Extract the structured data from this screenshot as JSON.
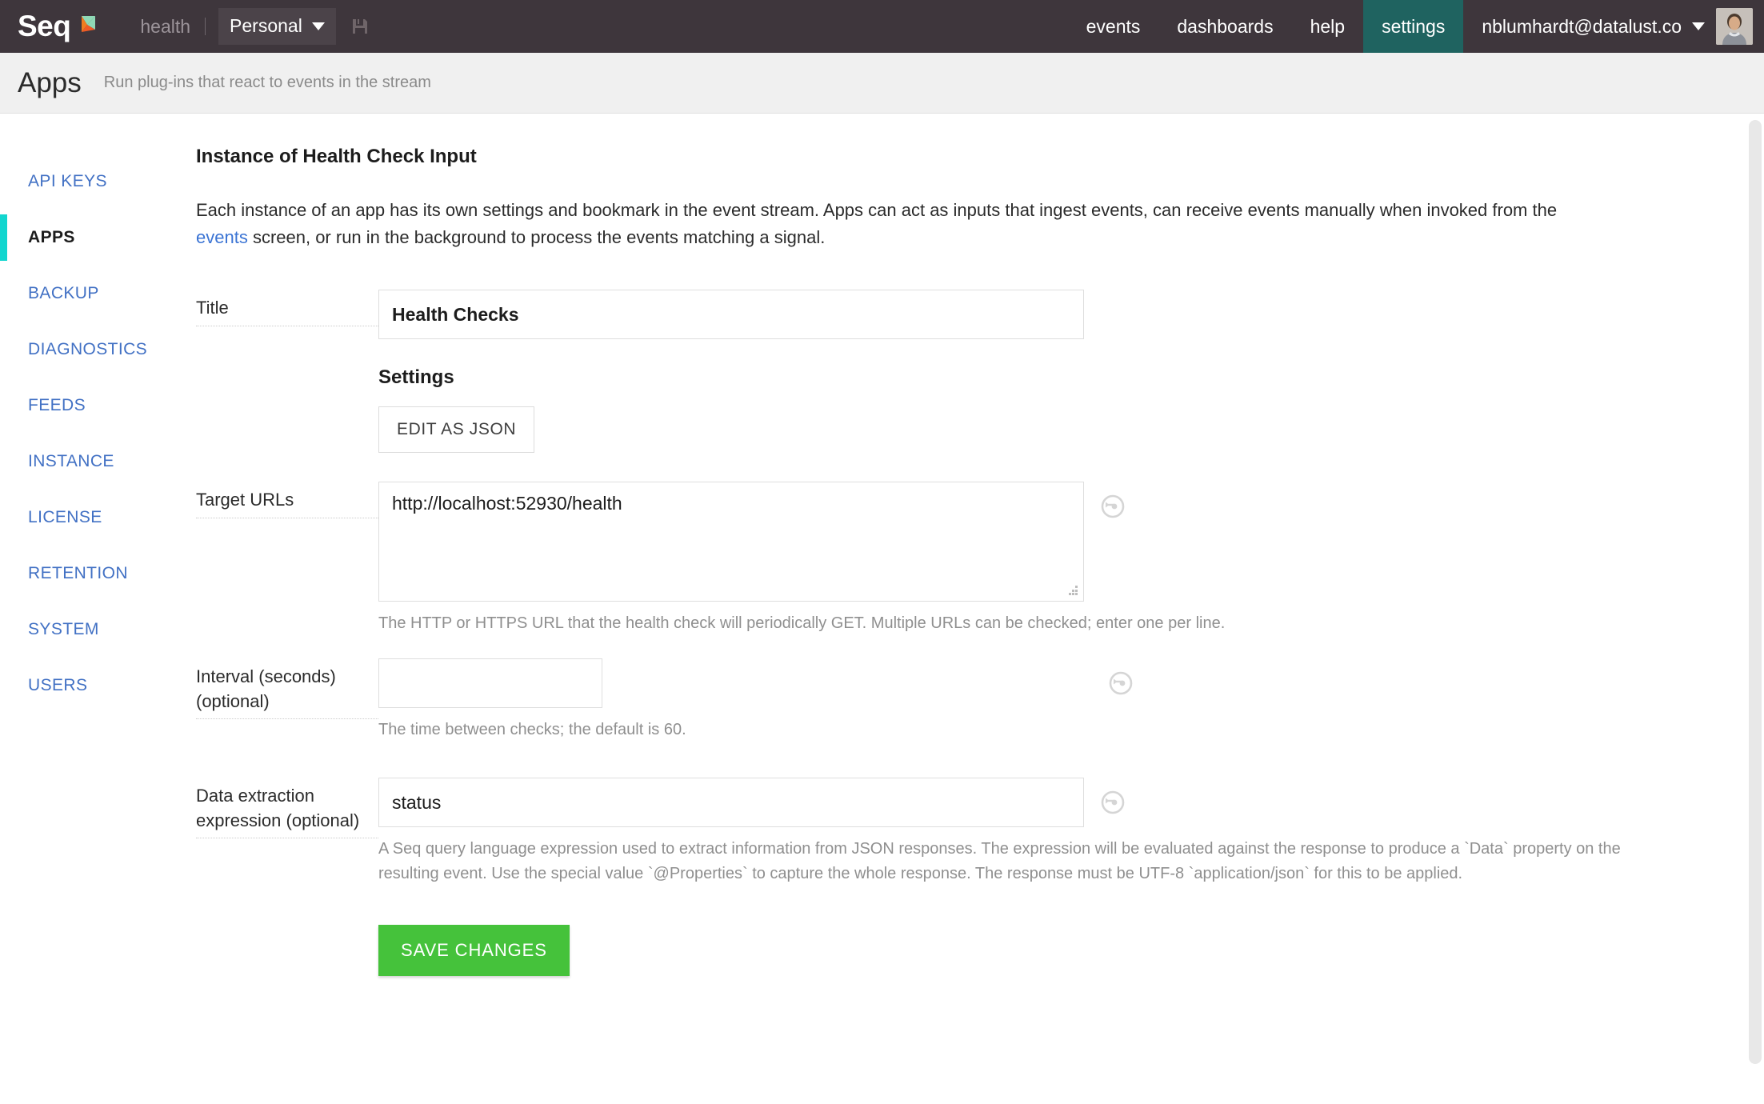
{
  "topnav": {
    "brand": "Seq",
    "brand_mark_icon": "seq-flag-logo",
    "context_name": "health",
    "workspace_label": "Personal",
    "workspace_caret_icon": "chevron-down-icon",
    "save_view_icon": "floppy-save-icon",
    "links": [
      {
        "label": "events",
        "active": false
      },
      {
        "label": "dashboards",
        "active": false
      },
      {
        "label": "help",
        "active": false
      },
      {
        "label": "settings",
        "active": true
      }
    ],
    "user_email": "nblumhardt@datalust.co",
    "user_caret_icon": "chevron-down-icon",
    "avatar_icon": "user-avatar",
    "colors": {
      "nav_background": "#3e363c",
      "active_tab": "#1f6360",
      "workspace_chip": "#4b4349"
    }
  },
  "page_header": {
    "title": "Apps",
    "subtitle": "Run plug-ins that react to events in the stream"
  },
  "sidebar": {
    "items": [
      {
        "label": "API KEYS",
        "active": false
      },
      {
        "label": "APPS",
        "active": true
      },
      {
        "label": "BACKUP",
        "active": false
      },
      {
        "label": "DIAGNOSTICS",
        "active": false
      },
      {
        "label": "FEEDS",
        "active": false
      },
      {
        "label": "INSTANCE",
        "active": false
      },
      {
        "label": "LICENSE",
        "active": false
      },
      {
        "label": "RETENTION",
        "active": false
      },
      {
        "label": "SYSTEM",
        "active": false
      },
      {
        "label": "USERS",
        "active": false
      }
    ],
    "active_marker_color": "#12d6cf",
    "link_color": "#4271c4"
  },
  "main": {
    "heading": "Instance of Health Check Input",
    "description_part1": "Each instance of an app has its own settings and bookmark in the event stream. Apps can act as inputs that ingest events, can receive events manually when invoked from the ",
    "description_link": "events",
    "description_part2": " screen, or run in the background to process the events matching a signal.",
    "app_logo_icon": "app-logo-mark",
    "title_field": {
      "label": "Title",
      "value": "Health Checks",
      "placeholder": ""
    },
    "settings_heading": "Settings",
    "edit_as_json_label": "EDIT AS JSON",
    "target_urls_field": {
      "label": "Target URLs",
      "value": "http://localhost:52930/health",
      "placeholder": "",
      "help": "The HTTP or HTTPS URL that the health check will periodically GET. Multiple URLs can be checked; enter one per line.",
      "reset_icon": "reset-circular-arrow-icon",
      "resize_grip_icon": "resize-grip-icon"
    },
    "interval_field": {
      "label": "Interval (seconds) (optional)",
      "value": "",
      "placeholder": "",
      "help": "The time between checks; the default is 60.",
      "reset_icon": "reset-circular-arrow-icon"
    },
    "data_extraction_field": {
      "label": "Data extraction expression (optional)",
      "value": "status",
      "placeholder": "",
      "help": "A Seq query language expression used to extract information from JSON responses. The expression will be evaluated against the response to produce a `Data` property on the resulting event. Use the special value `@Properties` to capture the whole response. The response must be UTF-8 `application/json` for this to be applied.",
      "reset_icon": "reset-circular-arrow-icon"
    },
    "save_button_label": "SAVE CHANGES",
    "save_button_color": "#45c23b"
  }
}
